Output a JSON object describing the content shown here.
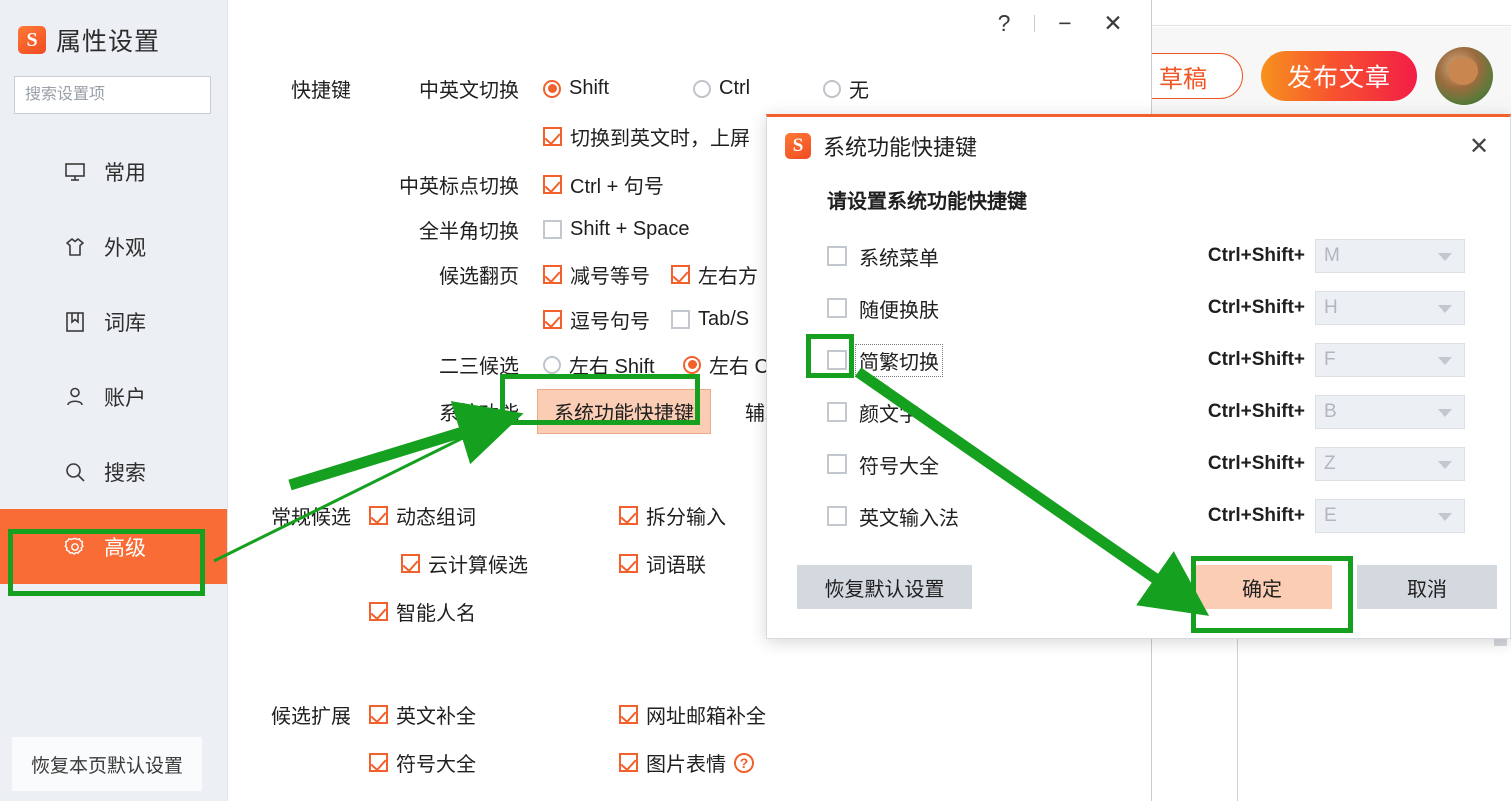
{
  "background_page": {
    "draft_label": "草稿",
    "publish_label": "发布文章",
    "avatar_name": "user-avatar"
  },
  "settings_window": {
    "brand": {
      "logo": "sogou-s-logo",
      "title": "属性设置"
    },
    "search": {
      "placeholder": "搜索设置项",
      "value": "",
      "icon": "search-icon"
    },
    "window_controls": {
      "help": "?",
      "minimize": "−",
      "close": "✕"
    },
    "nav": {
      "items": [
        {
          "label": "常用",
          "icon": "monitor-icon",
          "active": false
        },
        {
          "label": "外观",
          "icon": "shirt-icon",
          "active": false
        },
        {
          "label": "词库",
          "icon": "book-icon",
          "active": false
        },
        {
          "label": "账户",
          "icon": "user-icon",
          "active": false
        },
        {
          "label": "搜索",
          "icon": "search-icon",
          "active": false
        },
        {
          "label": "高级",
          "icon": "gear-icon",
          "active": true
        }
      ]
    },
    "reset_page_label": "恢复本页默认设置",
    "sections": {
      "hotkey": {
        "label": "快捷键",
        "rows": [
          {
            "label": "中英文切换",
            "options": [
              {
                "type": "radio",
                "label": "Shift",
                "checked": true
              },
              {
                "type": "radio",
                "label": "Ctrl",
                "checked": false
              },
              {
                "type": "radio",
                "label": "无",
                "checked": false
              }
            ]
          },
          {
            "label": "",
            "options": [
              {
                "type": "checkbox",
                "label": "切换到英文时，上屏",
                "checked": true
              }
            ]
          },
          {
            "label": "中英标点切换",
            "options": [
              {
                "type": "checkbox",
                "label": "Ctrl + 句号",
                "checked": true
              }
            ]
          },
          {
            "label": "全半角切换",
            "options": [
              {
                "type": "checkbox",
                "label": "Shift + Space",
                "checked": false
              }
            ]
          },
          {
            "label": "候选翻页",
            "options": [
              {
                "type": "checkbox",
                "label": "减号等号",
                "checked": true
              },
              {
                "type": "checkbox",
                "label": "左右方",
                "checked": true
              }
            ]
          },
          {
            "label": "",
            "options": [
              {
                "type": "checkbox",
                "label": "逗号句号",
                "checked": true
              },
              {
                "type": "checkbox",
                "label": "Tab/S",
                "checked": false
              }
            ]
          },
          {
            "label": "二三候选",
            "options": [
              {
                "type": "radio",
                "label": "左右 Shift",
                "checked": false
              },
              {
                "type": "radio",
                "label": "左右 C",
                "checked": true
              }
            ]
          }
        ],
        "system_function": {
          "label": "系统功能",
          "button_label": "系统功能快捷键",
          "trailing_label": "辅助"
        }
      },
      "candidate": {
        "label": "常规候选",
        "rows": [
          {
            "left": {
              "label": "动态组词",
              "checked": true,
              "indent": false
            },
            "right": {
              "label": "拆分输入",
              "checked": true
            }
          },
          {
            "left": {
              "label": "云计算候选",
              "checked": true,
              "indent": true
            },
            "right": {
              "label": "词语联",
              "checked": true
            }
          },
          {
            "left": {
              "label": "智能人名",
              "checked": true,
              "indent": false
            },
            "right": null
          }
        ]
      },
      "extension": {
        "label": "候选扩展",
        "rows": [
          {
            "left": {
              "label": "英文补全",
              "checked": true
            },
            "right": {
              "label": "网址邮箱补全",
              "checked": true,
              "help": false
            }
          },
          {
            "left": {
              "label": "符号大全",
              "checked": true
            },
            "right": {
              "label": "图片表情",
              "checked": true,
              "help": true
            }
          }
        ]
      }
    }
  },
  "dialog": {
    "logo": "sogou-s-logo",
    "title": "系统功能快捷键",
    "close_label": "✕",
    "subtitle": "请设置系统功能快捷键",
    "key_prefix": "Ctrl+Shift+",
    "rows": [
      {
        "label": "系统菜单",
        "checked": false,
        "key": "M",
        "focused": false
      },
      {
        "label": "随便换肤",
        "checked": false,
        "key": "H",
        "focused": false
      },
      {
        "label": "简繁切换",
        "checked": false,
        "key": "F",
        "focused": true
      },
      {
        "label": "颜文字",
        "checked": false,
        "key": "B",
        "focused": false
      },
      {
        "label": "符号大全",
        "checked": false,
        "key": "Z",
        "focused": false
      },
      {
        "label": "英文输入法",
        "checked": false,
        "key": "E",
        "focused": false
      }
    ],
    "buttons": {
      "restore": "恢复默认设置",
      "ok": "确定",
      "cancel": "取消"
    }
  },
  "annotations": {
    "highlight_color": "#16a020",
    "arrow_color": "#16a020",
    "highlights": [
      {
        "name": "highlight-nav-advanced"
      },
      {
        "name": "highlight-system-function-button"
      },
      {
        "name": "highlight-traditional-switch-checkbox"
      },
      {
        "name": "highlight-ok-button"
      }
    ],
    "arrows": [
      {
        "name": "arrow-advanced-to-system-function"
      },
      {
        "name": "arrow-checkbox-to-ok"
      }
    ]
  },
  "theme": {
    "accent_orange": "#f2602c",
    "sidebar_active": "#f96c36",
    "button_highlight_fill": "#fbcdb4",
    "annotation_green": "#16a020"
  }
}
